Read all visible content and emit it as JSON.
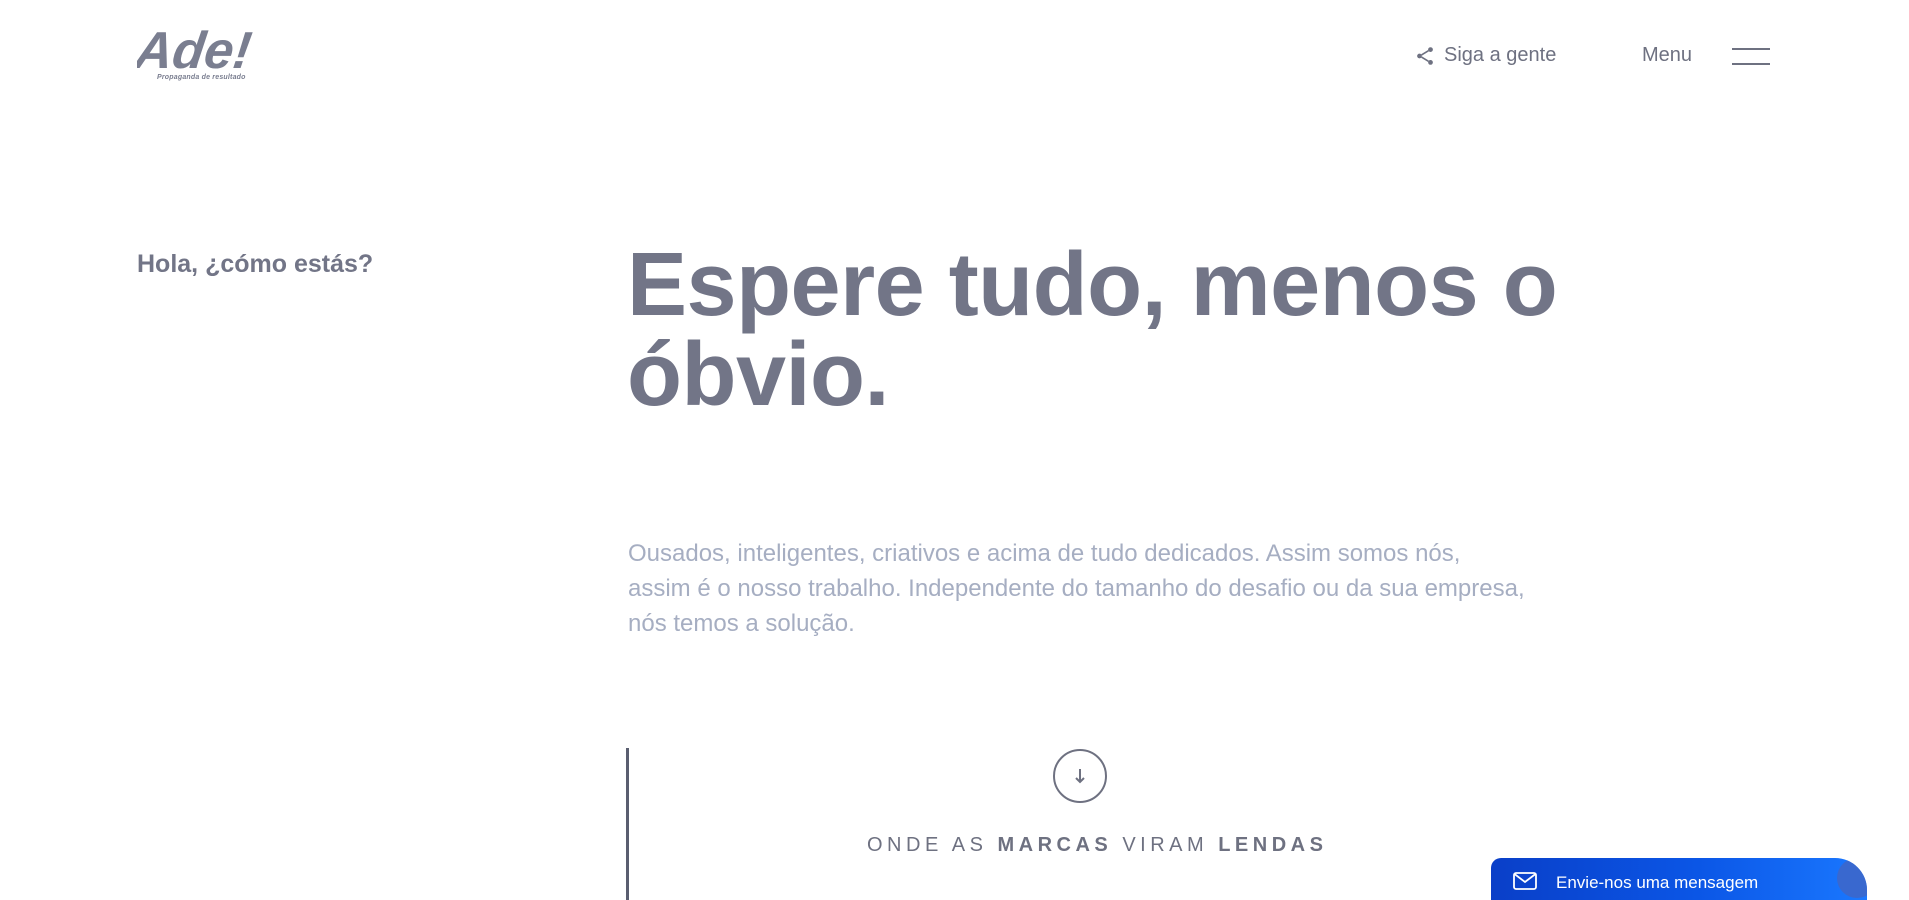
{
  "header": {
    "logo_text": "Ade!",
    "logo_tagline": "Propaganda de resultado",
    "follow_label": "Siga a gente",
    "menu_label": "Menu"
  },
  "hero": {
    "greeting": "Hola, ¿cómo estás?",
    "headline": "Espere tudo, menos o óbvio.",
    "lead": "Ousados, inteligentes, criativos e acima de tudo dedicados. Assim somos nós, assim é o nosso trabalho. Independente do tamanho do desafio ou da sua empresa, nós temos a solução."
  },
  "section": {
    "tagline": {
      "part1": "ONDE AS ",
      "bold1": "MARCAS",
      "part2": " VIRAM ",
      "bold2": "LENDAS"
    }
  },
  "chat": {
    "label": "Envie-nos uma mensagem"
  },
  "colors": {
    "text_primary": "#727587",
    "text_muted": "#a6aec2",
    "accent_blue": "#0b56e6"
  },
  "icons": {
    "share": "share-icon",
    "menu": "hamburger-icon",
    "scroll": "arrow-down-icon",
    "mail": "mail-icon"
  }
}
